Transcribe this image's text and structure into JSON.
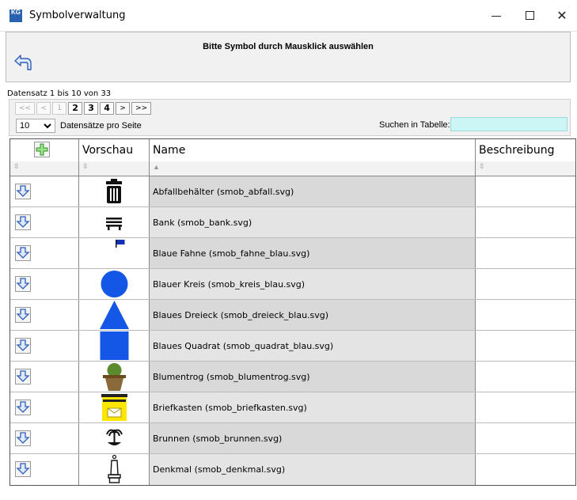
{
  "window": {
    "title": "Symbolverwaltung",
    "icon_text": "KG",
    "minimize_icon": "minimize-icon",
    "maximize_icon": "maximize-icon",
    "close_icon": "close-icon",
    "close_glyph": "✕"
  },
  "header": {
    "instruction": "Bitte Symbol durch Mausklick auswählen",
    "back_icon": "back-arrow-icon"
  },
  "paging": {
    "record_info": "Datensatz 1 bis 10 von 33",
    "first": "<<",
    "prev": "<",
    "pages": [
      "1",
      "2",
      "3",
      "4"
    ],
    "current_page": "1",
    "next": ">",
    "last": ">>",
    "per_page_value": "10",
    "per_page_label": "Datensätze pro Seite",
    "search_label": "Suchen in Tabelle:",
    "search_value": ""
  },
  "table": {
    "columns": {
      "actions": "",
      "preview": "Vorschau",
      "name": "Name",
      "description": "Beschreibung"
    },
    "sort_both_glyph": "⇳",
    "sort_up_glyph": "▲",
    "add_icon": "plus-icon",
    "down_icon": "arrow-down-icon",
    "accent": "#4a7fd4",
    "rows": [
      {
        "name": "Abfallbehälter (smob_abfall.svg)",
        "symbol": "trash-can-icon",
        "description": ""
      },
      {
        "name": "Bank (smob_bank.svg)",
        "symbol": "bench-icon",
        "description": ""
      },
      {
        "name": "Blaue Fahne (smob_fahne_blau.svg)",
        "symbol": "blue-flag-icon",
        "description": ""
      },
      {
        "name": "Blauer Kreis (smob_kreis_blau.svg)",
        "symbol": "blue-circle-icon",
        "description": ""
      },
      {
        "name": "Blaues Dreieck (smob_dreieck_blau.svg)",
        "symbol": "blue-triangle-icon",
        "description": ""
      },
      {
        "name": "Blaues Quadrat (smob_quadrat_blau.svg)",
        "symbol": "blue-square-icon",
        "description": ""
      },
      {
        "name": "Blumentrog (smob_blumentrog.svg)",
        "symbol": "planter-icon",
        "description": ""
      },
      {
        "name": "Briefkasten (smob_briefkasten.svg)",
        "symbol": "mailbox-icon",
        "description": ""
      },
      {
        "name": "Brunnen (smob_brunnen.svg)",
        "symbol": "fountain-icon",
        "description": ""
      },
      {
        "name": "Denkmal (smob_denkmal.svg)",
        "symbol": "monument-icon",
        "description": ""
      }
    ]
  }
}
